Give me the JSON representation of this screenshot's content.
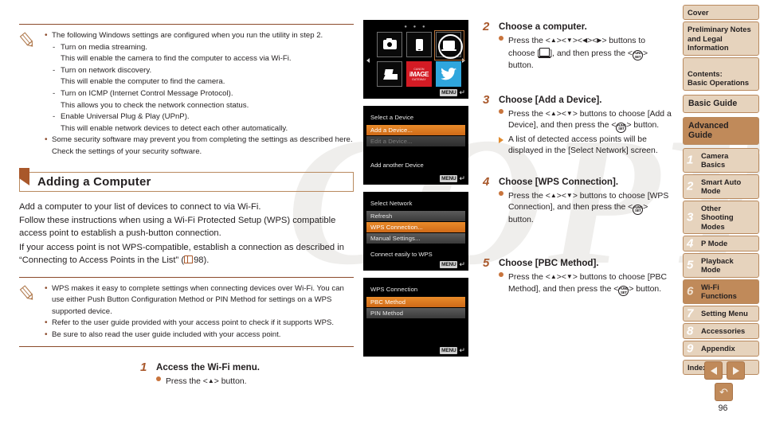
{
  "page": {
    "number": "96"
  },
  "top_note": {
    "icon": "pencil-note-icon",
    "items": [
      {
        "text": "The following Windows settings are configured when you run the utility in step 2.",
        "subs": [
          {
            "dash": "Turn on media streaming.",
            "cont": "This will enable the camera to find the computer to access via Wi-Fi."
          },
          {
            "dash": "Turn on network discovery.",
            "cont": "This will enable the computer to find the camera."
          },
          {
            "dash": "Turn on ICMP (Internet Control Message Protocol).",
            "cont": "This allows you to check the network connection status."
          },
          {
            "dash": "Enable Universal Plug & Play (UPnP).",
            "cont": "This will enable network devices to detect each other automatically."
          }
        ]
      },
      {
        "text": "Some security software may prevent you from completing the settings as described here. Check the settings of your security software.",
        "subs": []
      }
    ]
  },
  "section": {
    "title": "Adding a Computer",
    "paragraphs": [
      "Add a computer to your list of devices to connect to via Wi-Fi.",
      "Follow these instructions when using a Wi-Fi Protected Setup (WPS) compatible access point to establish a push-button connection."
    ],
    "paragraph_ref_pre": "If your access point is not WPS-compatible, establish a connection as described in “Connecting to Access Points in the List” (",
    "paragraph_ref_page": "98",
    "paragraph_ref_post": ")."
  },
  "bottom_note": {
    "icon": "pencil-note-icon",
    "items": [
      "WPS makes it easy to complete settings when connecting devices over Wi-Fi. You can use either Push Button Configuration Method or PIN Method for settings on a WPS supported device.",
      "Refer to the user guide provided with your access point to check if it supports WPS.",
      "Be sure to also read the user guide included with your access point."
    ]
  },
  "steps": [
    {
      "num": "1",
      "title": "Access the Wi-Fi menu.",
      "items": [
        {
          "kind": "dot",
          "pre": "Press the <",
          "key": "▲",
          "post": "> button."
        }
      ]
    },
    {
      "num": "2",
      "title": "Choose a computer.",
      "items": [
        {
          "kind": "dot",
          "text": "Press the <▲><▼><◀><▶> buttons to choose [monitor], and then press the <FUNC./SET> button."
        }
      ]
    },
    {
      "num": "3",
      "title": "Choose [Add a Device].",
      "items": [
        {
          "kind": "dot",
          "text": "Press the <▲><▼> buttons to choose [Add a Device], and then press the <FUNC./SET> button."
        },
        {
          "kind": "tri",
          "text": "A list of detected access points will be displayed in the [Select Network] screen."
        }
      ]
    },
    {
      "num": "4",
      "title": "Choose [WPS Connection].",
      "items": [
        {
          "kind": "dot",
          "text": "Press the <▲><▼> buttons to choose [WPS Connection], and then press the <FUNC./SET> button."
        }
      ]
    },
    {
      "num": "5",
      "title": "Choose [PBC Method].",
      "items": [
        {
          "kind": "dot",
          "text": "Press the <▲><▼> buttons to choose [PBC Method], and then press the <FUNC./SET> button."
        }
      ]
    }
  ],
  "step_text": {
    "s2_pre": "Press the <",
    "s2_a1": "▲",
    "s2_a2": "▼",
    "s2_a3": "◀",
    "s2_a4": "▶",
    "s2_mid": "> buttons to choose [",
    "s2_post": "], and then press the <",
    "s2_end": "> button.",
    "s3_mid": "> buttons to choose [Add a Device], and then press the <",
    "s3_note": "A list of detected access points will be displayed in the [Select Network] screen.",
    "s4_mid": "> buttons to choose [WPS Connection], and then press the <",
    "s5_mid": "> buttons to choose [PBC Method], and then press the <",
    "btn_fn_l1": "FUNC.",
    "btn_fn_l2": "SET"
  },
  "screens": [
    {
      "name": "wifi-device-menu",
      "type": "grid",
      "dots": "● ● ●",
      "cells": [
        {
          "icon": "camera-icon",
          "label": ""
        },
        {
          "icon": "smartphone-icon",
          "label": ""
        },
        {
          "icon": "computer-icon",
          "label": "",
          "selected": true
        },
        {
          "icon": "printer-icon",
          "label": ""
        },
        {
          "icon": "canon-image-gateway-icon",
          "l1": "CANON",
          "l2": "iMAGE",
          "l3": "GATEWAY"
        },
        {
          "icon": "twitter-icon",
          "label": ""
        }
      ],
      "menu_label": "MENU"
    },
    {
      "name": "select-a-device",
      "type": "list",
      "title": "Select a Device",
      "rows": [
        {
          "label": "Add a Device...",
          "state": "selected"
        },
        {
          "label": "Edit a Device...",
          "state": "disabled"
        }
      ],
      "footer": "Add another Device",
      "menu_label": "MENU"
    },
    {
      "name": "select-network",
      "type": "list",
      "title": "Select Network",
      "rows": [
        {
          "label": "Refresh",
          "state": "grey"
        },
        {
          "label": "WPS Connection...",
          "state": "selected"
        },
        {
          "label": "Manual Settings...",
          "state": "grey"
        }
      ],
      "footer": "Connect easily to WPS",
      "menu_label": "MENU"
    },
    {
      "name": "wps-connection",
      "type": "list",
      "title": "WPS Connection",
      "rows": [
        {
          "label": "PBC Method",
          "state": "selected"
        },
        {
          "label": "PIN Method",
          "state": "grey"
        }
      ],
      "footer": "",
      "menu_label": "MENU"
    }
  ],
  "sidebar": {
    "tabs": [
      {
        "label": "Cover",
        "type": "plain"
      },
      {
        "label": "Preliminary Notes and Legal Information",
        "type": "plain"
      },
      {
        "label": "Contents:\nBasic Operations",
        "type": "plain"
      },
      {
        "label": "Basic Guide",
        "type": "big"
      },
      {
        "label": "Advanced Guide",
        "type": "section"
      }
    ],
    "chapters": [
      {
        "num": "1",
        "label": "Camera Basics",
        "active": false
      },
      {
        "num": "2",
        "label": "Smart Auto Mode",
        "active": false
      },
      {
        "num": "3",
        "label": "Other Shooting Modes",
        "active": false
      },
      {
        "num": "4",
        "label": "P Mode",
        "active": false
      },
      {
        "num": "5",
        "label": "Playback Mode",
        "active": false
      },
      {
        "num": "6",
        "label": "Wi-Fi Functions",
        "active": true
      },
      {
        "num": "7",
        "label": "Setting Menu",
        "active": false
      },
      {
        "num": "8",
        "label": "Accessories",
        "active": false
      },
      {
        "num": "9",
        "label": "Appendix",
        "active": false
      }
    ],
    "index_label": "Index"
  },
  "bottom_nav": {
    "prev": "previous-page-arrow",
    "next": "next-page-arrow",
    "back": "back-button"
  },
  "colors": {
    "accent": "#a9582b",
    "tab_fill": "#e6d3bd",
    "tab_border": "#b98a5f",
    "tab_active": "#c08a5a",
    "lcd_selected": "#e98b2a"
  }
}
